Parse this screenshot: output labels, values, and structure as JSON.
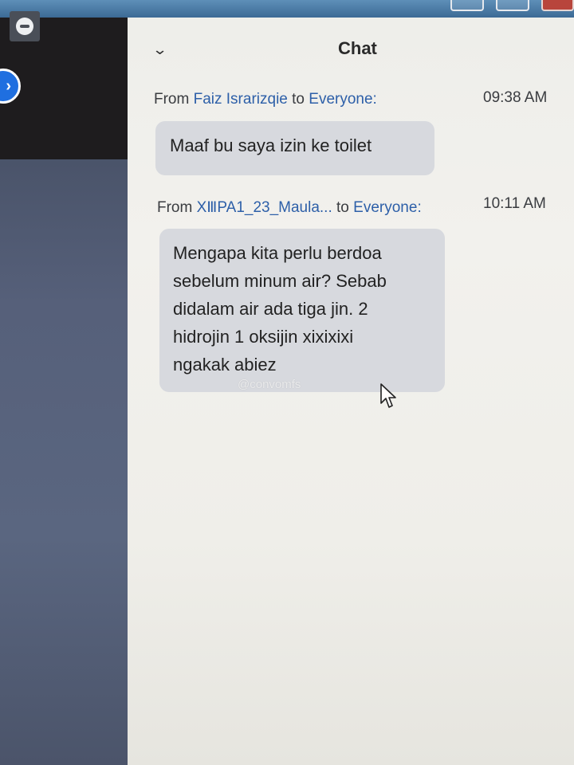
{
  "chat": {
    "title": "Chat",
    "messages": [
      {
        "prefix": "From",
        "sender": "Faiz Israrizqie",
        "to_word": "to",
        "recipient": "Everyone:",
        "time": "09:38 AM",
        "text": "Maaf bu saya izin ke toilet"
      },
      {
        "prefix": "From",
        "sender": "XⅢPA1_23_Maula...",
        "to_word": "to",
        "recipient": "Everyone:",
        "time": "10:11 AM",
        "lines": [
          "Mengapa kita perlu berdoa",
          "sebelum minum air? Sebab",
          "didalam air ada tiga jin. 2",
          "hidrojin 1 oksijin xixixixi",
          "ngakak abiez"
        ]
      }
    ]
  },
  "watermark": "@convomfs",
  "icons": {
    "app": "app-icon",
    "nav": "nav-arrow-icon",
    "collapse": "chevron-down-icon",
    "pointer": "mouse-cursor-icon"
  },
  "colors": {
    "link": "#2d5fa8",
    "bubble": "#d7d9de",
    "nav_button": "#1f6fe0"
  }
}
